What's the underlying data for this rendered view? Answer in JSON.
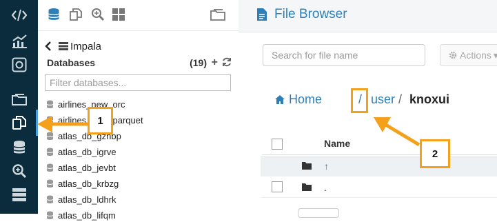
{
  "rail": {
    "icons": [
      "code-icon",
      "chart-icon",
      "jobs-icon",
      "folder-icon",
      "documents-icon",
      "database-icon",
      "search-icon",
      "server-icon"
    ]
  },
  "assist": {
    "breadcrumb_label": "Impala",
    "databases_title": "Databases",
    "databases_count": "(19)",
    "filter_placeholder": "Filter databases...",
    "databases": [
      "airlines_new_orc",
      "airlines_new_parquet",
      "atlas_db_gzhbp",
      "atlas_db_igrve",
      "atlas_db_jevbt",
      "atlas_db_krbzg",
      "atlas_db_ldhrk",
      "atlas_db_lifqm"
    ]
  },
  "main": {
    "title": "File Browser",
    "search_placeholder": "Search for file name",
    "actions_label": "Actions",
    "path": {
      "home": "Home",
      "sep1": "/",
      "user": "user",
      "sep2": "/",
      "current": "knoxui"
    },
    "table": {
      "col_name": "Name",
      "rows": [
        {
          "name": "↑"
        },
        {
          "name": "."
        }
      ]
    }
  },
  "annotations": {
    "callout_1": "1",
    "callout_2": "2",
    "color": "#f5a01a"
  },
  "colors": {
    "rail_bg": "#0b2c3d",
    "accent": "#2e7fb8"
  }
}
